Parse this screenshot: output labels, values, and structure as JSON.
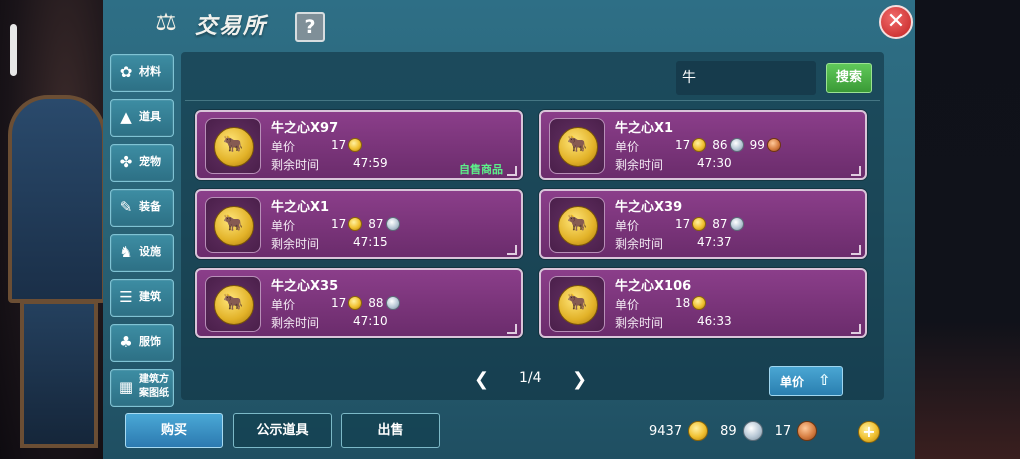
{
  "header": {
    "title": "交易所",
    "help": "?",
    "close": "✕"
  },
  "categories": [
    {
      "label": "材料",
      "icon": "flower-icon"
    },
    {
      "label": "道具",
      "icon": "flask-icon"
    },
    {
      "label": "宠物",
      "icon": "paw-icon"
    },
    {
      "label": "装备",
      "icon": "sword-icon"
    },
    {
      "label": "设施",
      "icon": "cart-icon"
    },
    {
      "label": "建筑",
      "icon": "building-icon"
    },
    {
      "label": "服饰",
      "icon": "shirt-icon"
    },
    {
      "label": "建筑方案图纸",
      "icon": "blueprint-icon"
    }
  ],
  "search": {
    "value": "牛",
    "button": "搜索"
  },
  "labels": {
    "price": "单价",
    "time_left": "剩余时间",
    "self_sale": "自售商品"
  },
  "listings": [
    {
      "name": "牛之心X97",
      "prices": [
        {
          "amount": "17",
          "coin": "gold"
        }
      ],
      "time": "47:59",
      "self": true
    },
    {
      "name": "牛之心X1",
      "prices": [
        {
          "amount": "17",
          "coin": "gold"
        },
        {
          "amount": "86",
          "coin": "silver"
        },
        {
          "amount": "99",
          "coin": "copper"
        }
      ],
      "time": "47:30",
      "self": false
    },
    {
      "name": "牛之心X1",
      "prices": [
        {
          "amount": "17",
          "coin": "gold"
        },
        {
          "amount": "87",
          "coin": "silver"
        }
      ],
      "time": "47:15",
      "self": false
    },
    {
      "name": "牛之心X39",
      "prices": [
        {
          "amount": "17",
          "coin": "gold"
        },
        {
          "amount": "87",
          "coin": "silver"
        }
      ],
      "time": "47:37",
      "self": false
    },
    {
      "name": "牛之心X35",
      "prices": [
        {
          "amount": "17",
          "coin": "gold"
        },
        {
          "amount": "88",
          "coin": "silver"
        }
      ],
      "time": "47:10",
      "self": false
    },
    {
      "name": "牛之心X106",
      "prices": [
        {
          "amount": "18",
          "coin": "gold"
        }
      ],
      "time": "46:33",
      "self": false
    }
  ],
  "pager": {
    "prev": "❮",
    "page": "1/4",
    "next": "❯"
  },
  "sort": {
    "label": "单价",
    "icon": "sort-up-icon"
  },
  "actions": {
    "buy": "购买",
    "show": "公示道具",
    "sell": "出售"
  },
  "wallet": {
    "gold": "9437",
    "silver": "89",
    "copper": "17"
  }
}
